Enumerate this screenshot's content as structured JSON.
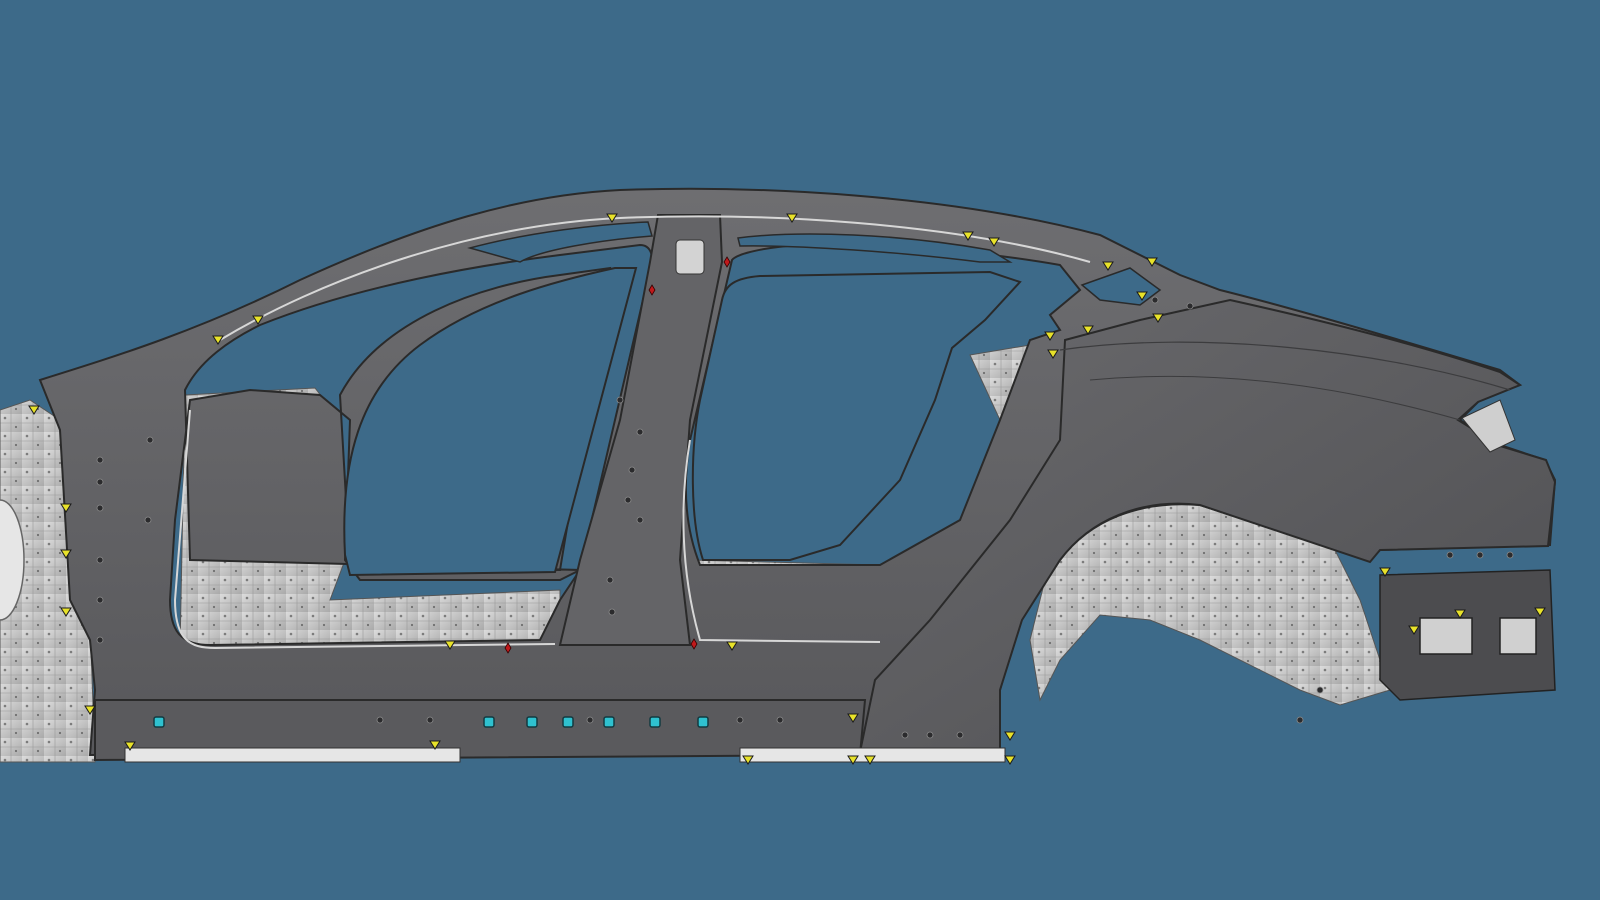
{
  "viewport": {
    "background_color": "#3d6a89"
  },
  "model": {
    "view": "side",
    "panel_color": "#5f5f61",
    "panel_light_color": "#6d6d70",
    "inner_structure_color": "#c9c9c9",
    "edge_color": "#2a2a2a",
    "highlight_color": "#d7d7d7"
  },
  "markers": {
    "yellow_color": "#e8e22a",
    "cyan_color": "#2fc1cf",
    "red_color": "#c0191b"
  }
}
